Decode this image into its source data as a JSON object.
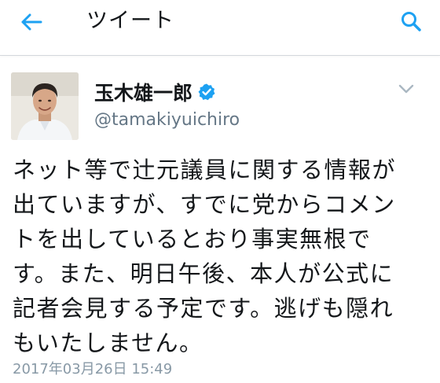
{
  "header": {
    "title": "ツイート",
    "back_icon": "back-arrow-icon",
    "search_icon": "search-icon",
    "accent_color": "#1da1f2"
  },
  "tweet": {
    "display_name": "玉木雄一郎",
    "verified": true,
    "handle": "@tamakiyuichiro",
    "text_lines": [
      "ネット等で辻元議員に関する情報が",
      "出ていますが、すでに党からコメン",
      "トを出しているとおり事実無根で",
      "す。また、明日午後、本人が公式に",
      "記者会見する予定です。逃げも隠れ",
      "もいたしません。"
    ],
    "timestamp": "2017年03月26日 15:49"
  }
}
